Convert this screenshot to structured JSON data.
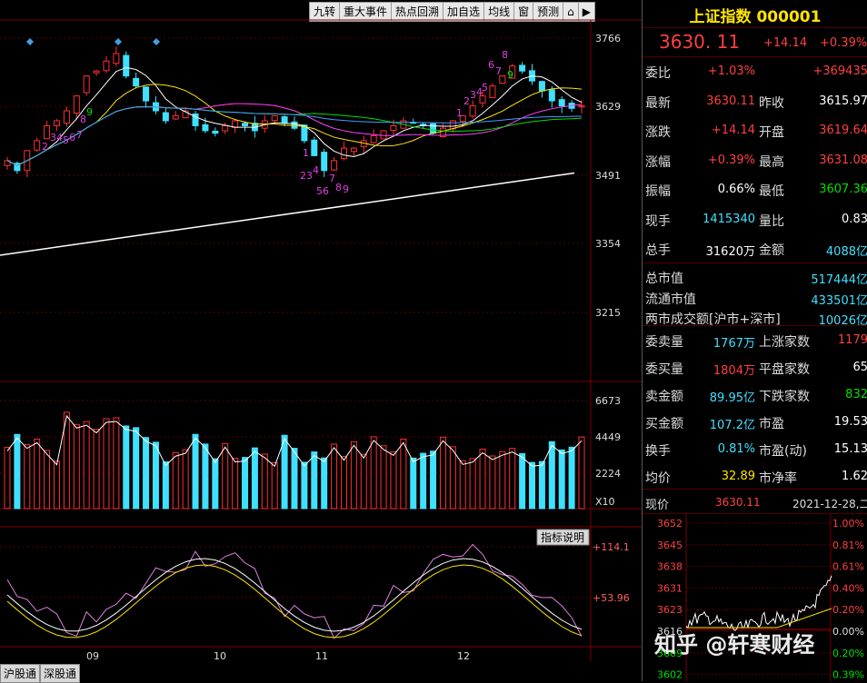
{
  "toolbar": {
    "items": [
      "九转",
      "重大事件",
      "热点回溯",
      "加自选",
      "均线",
      "窗",
      "预测"
    ]
  },
  "main_axis": {
    "price_ticks": [
      "3766",
      "3629",
      "3491",
      "3354",
      "3215"
    ],
    "volume_ticks": [
      "6673",
      "4449",
      "2224"
    ],
    "volume_unit": "X10",
    "indicator_ticks": [
      "+114.1",
      "+53.96"
    ],
    "indicator_button": "指标说明",
    "month_labels": [
      "09",
      "10",
      "11",
      "12"
    ]
  },
  "nine_turn_labels": {
    "up1": [
      "2",
      "3",
      "4",
      "5",
      "6",
      "7",
      "8",
      "9"
    ],
    "down1": [
      "1",
      "2",
      "3",
      "4",
      "5",
      "6",
      "7",
      "8",
      "9"
    ],
    "up2": [
      "1",
      "2",
      "3",
      "4",
      "5",
      "6",
      "7",
      "8",
      "9"
    ]
  },
  "panel": {
    "title": "上证指数 000001",
    "price": "3630. 11",
    "change": "+14.14",
    "change_pct": "+0.39%",
    "rows": [
      {
        "lab": "委比",
        "val": "+1.03%",
        "val_cls": "red",
        "lab2": "",
        "val2": "+369435",
        "val2_cls": "red"
      },
      {
        "lab": "最新",
        "val": "3630.11",
        "val_cls": "red",
        "lab2": "昨收",
        "val2": "3615.97",
        "val2_cls": "white"
      },
      {
        "lab": "涨跌",
        "val": "+14.14",
        "val_cls": "red",
        "lab2": "开盘",
        "val2": "3619.64",
        "val2_cls": "red"
      },
      {
        "lab": "涨幅",
        "val": "+0.39%",
        "val_cls": "red",
        "lab2": "最高",
        "val2": "3631.08",
        "val2_cls": "red"
      },
      {
        "lab": "振幅",
        "val": "0.66%",
        "val_cls": "white",
        "lab2": "最低",
        "val2": "3607.36",
        "val2_cls": "green"
      },
      {
        "lab": "现手",
        "val": "1415340",
        "val_cls": "cyan",
        "lab2": "量比",
        "val2": "0.83",
        "val2_cls": "white"
      },
      {
        "lab": "总手",
        "val": "31620万",
        "val_cls": "white",
        "lab2": "金额",
        "val2": "4088亿",
        "val2_cls": "cyan"
      }
    ],
    "rows_b": [
      {
        "lab": "总市值",
        "val": "517444亿",
        "val_cls": "cyan"
      },
      {
        "lab": "流通市值",
        "val": "433501亿",
        "val_cls": "cyan"
      },
      {
        "lab": "两市成交额[沪市+深市]",
        "val": "10026亿",
        "val_cls": "cyan"
      }
    ],
    "rows_c": [
      {
        "lab": "委卖量",
        "val": "1767万",
        "val_cls": "cyan",
        "lab2": "上涨家数",
        "val2": "1179",
        "val2_cls": "red"
      },
      {
        "lab": "委买量",
        "val": "1804万",
        "val_cls": "red",
        "lab2": "平盘家数",
        "val2": "65",
        "val2_cls": "white"
      },
      {
        "lab": "卖金额",
        "val": "89.95亿",
        "val_cls": "cyan",
        "lab2": "下跌家数",
        "val2": "832",
        "val2_cls": "green"
      },
      {
        "lab": "买金额",
        "val": "107.2亿",
        "val_cls": "cyan",
        "lab2": "市盈",
        "val2": "19.53",
        "val2_cls": "white"
      },
      {
        "lab": "换手",
        "val": "0.81%",
        "val_cls": "cyan",
        "lab2": "市盈(动)",
        "val2": "15.13",
        "val2_cls": "white"
      },
      {
        "lab": "均价",
        "val": "32.89",
        "val_cls": "yellow",
        "lab2": "市净率",
        "val2": "1.62",
        "val2_cls": "white"
      }
    ],
    "now_label": "现价",
    "now_val": "3630.11",
    "date": "2021-12-28,二",
    "intraday_left": [
      "3652",
      "3645",
      "3638",
      "3631",
      "3623",
      "3616",
      "3609",
      "3602"
    ],
    "intraday_right": [
      "1.00%",
      "0.81%",
      "0.61%",
      "0.40%",
      "0.20%",
      "0.00%",
      "0.20%",
      "0.39%"
    ]
  },
  "tabs": [
    "沪股通",
    "深股通"
  ],
  "watermark": "知乎 @轩寒财经",
  "chart_data": {
    "type": "candlestick",
    "price_ylim": [
      3160,
      3800
    ],
    "price_closes": [
      3520,
      3500,
      3540,
      3560,
      3590,
      3600,
      3620,
      3650,
      3690,
      3700,
      3720,
      3735,
      3690,
      3670,
      3640,
      3620,
      3600,
      3610,
      3620,
      3590,
      3580,
      3575,
      3590,
      3600,
      3590,
      3580,
      3600,
      3610,
      3595,
      3585,
      3560,
      3530,
      3500,
      3520,
      3545,
      3545,
      3560,
      3570,
      3580,
      3590,
      3600,
      3595,
      3590,
      3575,
      3585,
      3600,
      3610,
      3630,
      3650,
      3670,
      3690,
      3710,
      3700,
      3680,
      3660,
      3640,
      3630,
      3625,
      3630
    ],
    "ma_long_start": 3330,
    "ma_long_end": 3495,
    "volume_ylim": [
      0,
      7000
    ],
    "volume_ref": [
      4449,
      2224
    ],
    "indicator_ref": [
      114.1,
      53.96
    ]
  }
}
